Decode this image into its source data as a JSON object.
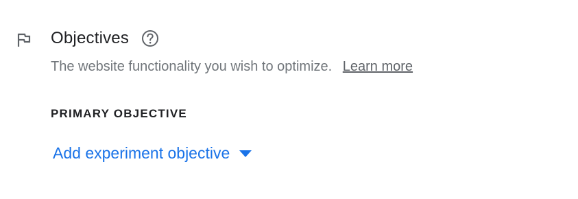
{
  "section": {
    "icon": "flag-icon",
    "title": "Objectives",
    "help_icon": "help-circle-icon",
    "description": "The website functionality you wish to optimize.",
    "learn_more_label": "Learn more"
  },
  "primary_objective": {
    "heading": "PRIMARY OBJECTIVE",
    "add_label": "Add experiment objective",
    "dropdown_icon": "arrow-drop-down-icon"
  },
  "colors": {
    "accent": "#1a73e8",
    "title_text": "#202124",
    "secondary_text": "#70757a",
    "icon": "#5f6368"
  }
}
